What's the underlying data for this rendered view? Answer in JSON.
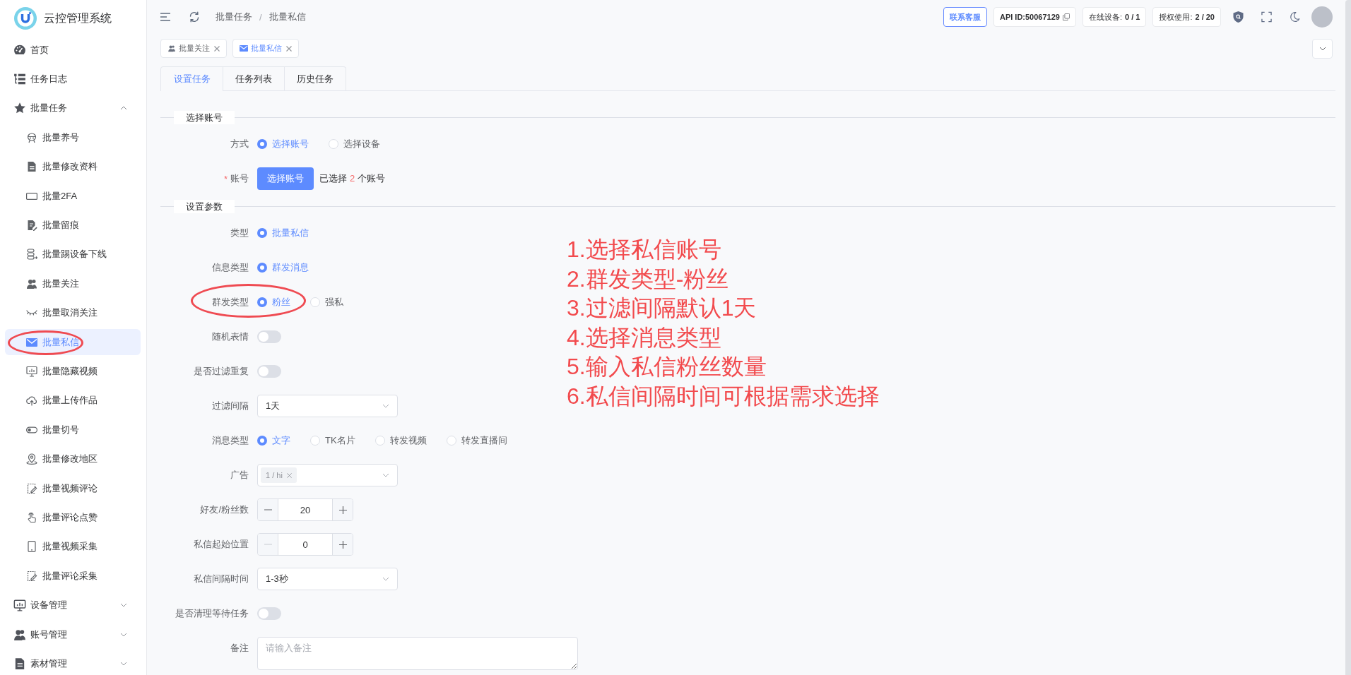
{
  "app": {
    "title": "云控管理系统"
  },
  "sidebar": {
    "items": [
      {
        "label": "首页",
        "selected": false
      },
      {
        "label": "任务日志",
        "selected": false
      },
      {
        "label": "批量任务",
        "selected": false,
        "expanded": true,
        "children": [
          {
            "label": "批量养号",
            "selected": false
          },
          {
            "label": "批量修改资料",
            "selected": false
          },
          {
            "label": "批量2FA",
            "selected": false
          },
          {
            "label": "批量留痕",
            "selected": false
          },
          {
            "label": "批量踢设备下线",
            "selected": false
          },
          {
            "label": "批量关注",
            "selected": false
          },
          {
            "label": "批量取消关注",
            "selected": false
          },
          {
            "label": "批量私信",
            "selected": true
          },
          {
            "label": "批量隐藏视频",
            "selected": false
          },
          {
            "label": "批量上传作品",
            "selected": false
          },
          {
            "label": "批量切号",
            "selected": false
          },
          {
            "label": "批量修改地区",
            "selected": false
          },
          {
            "label": "批量视频评论",
            "selected": false
          },
          {
            "label": "批量评论点赞",
            "selected": false
          },
          {
            "label": "批量视频采集",
            "selected": false
          },
          {
            "label": "批量评论采集",
            "selected": false
          }
        ]
      },
      {
        "label": "设备管理",
        "selected": false,
        "expanded": false
      },
      {
        "label": "账号管理",
        "selected": false,
        "expanded": false
      },
      {
        "label": "素材管理",
        "selected": false,
        "expanded": false
      }
    ]
  },
  "header": {
    "breadcrumb": {
      "items": [
        "批量任务",
        "批量私信"
      ],
      "separator": "/"
    },
    "contact_button": "联系客服",
    "badges": [
      {
        "kind": "copy",
        "text": "API ID:50067129"
      },
      {
        "kind": "stat",
        "label": "在线设备:",
        "value": "0 / 1"
      },
      {
        "kind": "stat",
        "label": "授权使用:",
        "value": "2 / 20"
      }
    ]
  },
  "open_pages": [
    {
      "label": "批量关注",
      "selected": false
    },
    {
      "label": "批量私信",
      "selected": true
    }
  ],
  "tabs": [
    {
      "label": "设置任务",
      "selected": true
    },
    {
      "label": "任务列表",
      "selected": false
    },
    {
      "label": "历史任务",
      "selected": false
    }
  ],
  "form": {
    "sections": [
      {
        "title": "选择账号",
        "fields": [
          {
            "kind": "radio",
            "label": "方式",
            "options": [
              {
                "label": "选择账号",
                "selected": true
              },
              {
                "label": "选择设备",
                "selected": false
              }
            ]
          },
          {
            "kind": "picker",
            "label": "账号",
            "required_mark": "*",
            "button": "选择账号",
            "summary": {
              "before": "已选择",
              "count": "2",
              "after": "个账号"
            }
          }
        ]
      },
      {
        "title": "设置参数",
        "fields": [
          {
            "kind": "radio",
            "label": "类型",
            "options": [
              {
                "label": "批量私信",
                "selected": true
              }
            ]
          },
          {
            "kind": "radio",
            "label": "信息类型",
            "options": [
              {
                "label": "群发消息",
                "selected": true
              }
            ]
          },
          {
            "kind": "radio",
            "label": "群发类型",
            "options": [
              {
                "label": "粉丝",
                "selected": true
              },
              {
                "label": "强私",
                "selected": false
              }
            ]
          },
          {
            "kind": "switch",
            "label": "随机表情",
            "on": false
          },
          {
            "kind": "switch",
            "label": "是否过滤重复",
            "on": false
          },
          {
            "kind": "select",
            "label": "过滤间隔",
            "value": "1天"
          },
          {
            "kind": "radio",
            "label": "消息类型",
            "options": [
              {
                "label": "文字",
                "selected": true
              },
              {
                "label": "TK名片",
                "selected": false
              },
              {
                "label": "转发视频",
                "selected": false
              },
              {
                "label": "转发直播间",
                "selected": false
              }
            ]
          },
          {
            "kind": "multiselect",
            "label": "广告",
            "tags": [
              "1 / hi"
            ]
          },
          {
            "kind": "number",
            "label": "好友/粉丝数",
            "value": "20",
            "decrease_disabled": false
          },
          {
            "kind": "number",
            "label": "私信起始位置",
            "value": "0",
            "decrease_disabled": true
          },
          {
            "kind": "select",
            "label": "私信间隔时间",
            "value": "1-3秒"
          },
          {
            "kind": "switch",
            "label": "是否清理等待任务",
            "on": false
          },
          {
            "kind": "textarea",
            "label": "备注",
            "placeholder": "请输入备注"
          }
        ]
      }
    ]
  },
  "annotation_notes": [
    "1.选择私信账号",
    "2.群发类型-粉丝",
    "3.过滤间隔默认1天",
    "4.选择消息类型",
    "5.输入私信粉丝数量",
    "6.私信间隔时间可根据需求选择"
  ]
}
